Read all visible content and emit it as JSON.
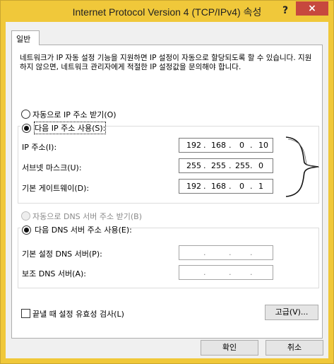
{
  "window": {
    "title": "Internet Protocol Version 4 (TCP/IPv4) 속성",
    "help_label": "?",
    "close_label": "×"
  },
  "tab": {
    "label": "일반"
  },
  "description": "네트워크가 IP 자동 설정 기능을 지원하면 IP 설정이 자동으로 할당되도록 할 수 있습니다. 지원하지 않으면, 네트워크 관리자에게 적절한 IP 설정값을 문의해야 합니다.",
  "ip_mode": {
    "auto_label": "자동으로 IP 주소 받기(O)",
    "manual_label": "다음 IP 주소 사용(S):",
    "selected": "manual"
  },
  "ip_fields": {
    "ip_label": "IP 주소(I):",
    "ip_octets": [
      "192",
      "168",
      "0",
      "10"
    ],
    "subnet_label": "서브넷 마스크(U):",
    "subnet_octets": [
      "255",
      "255",
      "255",
      "0"
    ],
    "gateway_label": "기본 게이트웨이(D):",
    "gateway_octets": [
      "192",
      "168",
      "0",
      "1"
    ]
  },
  "dns_mode": {
    "auto_label": "자동으로 DNS 서버 주소 받기(B)",
    "manual_label": "다음 DNS 서버 주소 사용(E):",
    "selected": "manual"
  },
  "dns_fields": {
    "preferred_label": "기본 설정 DNS 서버(P):",
    "alternate_label": "보조 DNS 서버(A):",
    "dot": "."
  },
  "validate": {
    "label": "끝낼 때 설정 유효성 검사(L)",
    "checked": false
  },
  "buttons": {
    "advanced": "고급(V)...",
    "ok": "확인",
    "cancel": "취소"
  },
  "colors": {
    "title_bar": "#f0c83a",
    "close_button": "#c7483e"
  }
}
